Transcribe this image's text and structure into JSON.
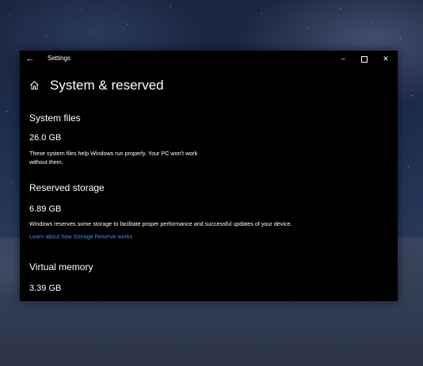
{
  "window": {
    "app_title": "Settings"
  },
  "page": {
    "title": "System & reserved"
  },
  "sections": {
    "system_files": {
      "title": "System files",
      "size": "26.0 GB",
      "description_line1": "These system files help Windows run properly. Your PC won't work",
      "description_line2": "without them."
    },
    "reserved_storage": {
      "title": "Reserved storage",
      "size": "6.89 GB",
      "description": "Windows reserves some storage to facilitate proper performance and successful updates of your device.",
      "link": "Learn about how Storage Reserve works"
    },
    "virtual_memory": {
      "title": "Virtual memory",
      "size": "3.39 GB"
    }
  },
  "colors": {
    "window_background": "#000000",
    "text": "#ffffff",
    "link": "#3c8fe0"
  },
  "icons": {
    "back": "arrow-left",
    "home": "house",
    "minimize": "minus",
    "maximize": "square",
    "close": "x"
  }
}
